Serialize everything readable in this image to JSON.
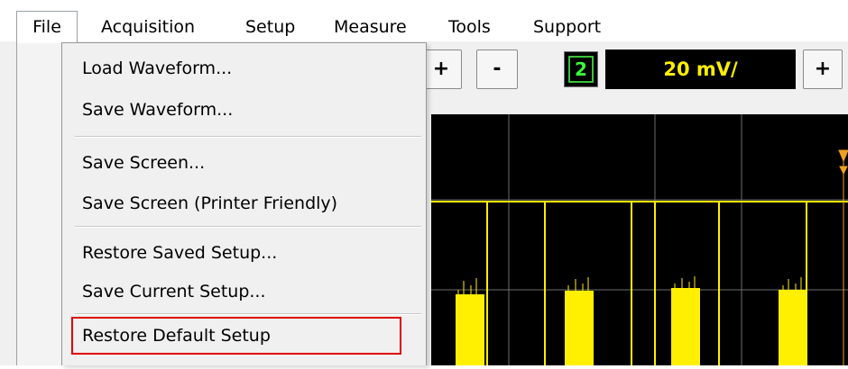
{
  "menubar": {
    "items": [
      "File",
      "Acquisition",
      "Setup",
      "Measure",
      "Tools",
      "Support"
    ]
  },
  "file_menu": {
    "items": [
      "Load Waveform...",
      "Save Waveform...",
      "Save Screen...",
      "Save Screen (Printer Friendly)",
      "Restore Saved Setup...",
      "Save Current Setup...",
      "Restore Default Setup"
    ],
    "highlighted": "Restore Default Setup"
  },
  "toolbar": {
    "plus_label": "+",
    "minus_label": "-",
    "channel_number": "2",
    "vertical_scale": "20 mV/",
    "plus_right_label": "+"
  },
  "colors": {
    "trace": "#ffef00",
    "grid": "#6e6e6e",
    "highlight_border": "#e00000",
    "channel_badge": "#39ff39",
    "scope_background": "#000000"
  }
}
